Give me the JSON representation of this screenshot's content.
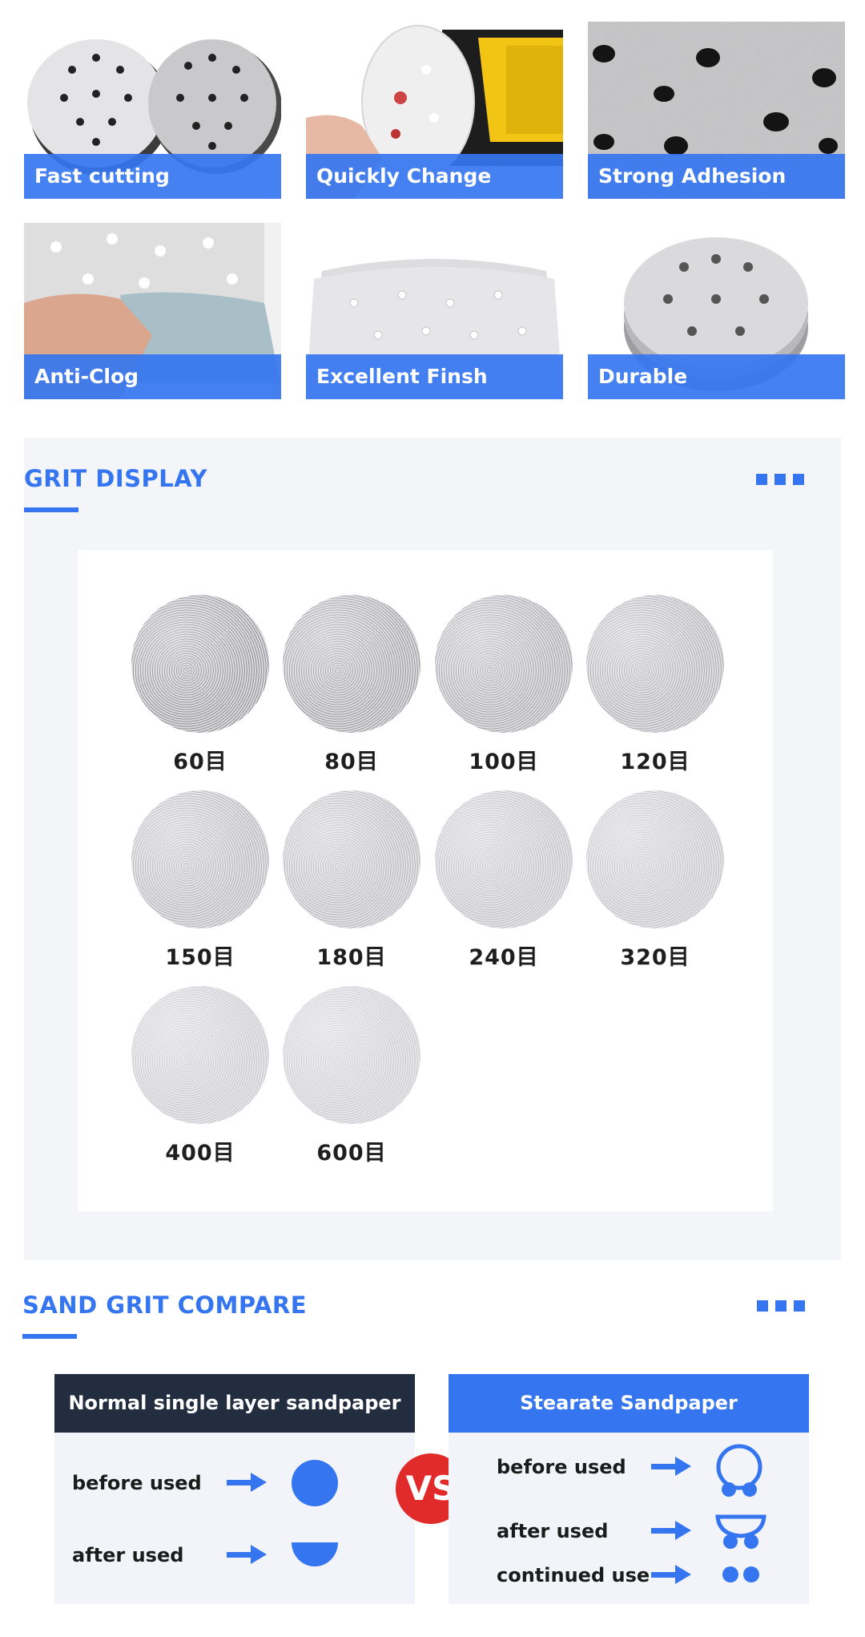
{
  "features": [
    {
      "label": "Fast cutting",
      "icon": "sanding-discs-photo"
    },
    {
      "label": "Quickly Change",
      "icon": "sander-disc-photo"
    },
    {
      "label": "Strong Adhesion",
      "icon": "abrasive-closeup-photo"
    },
    {
      "label": "Anti-Clog",
      "icon": "disc-backing-photo"
    },
    {
      "label": "Excellent Finsh",
      "icon": "stacked-discs-photo"
    },
    {
      "label": "Durable",
      "icon": "disc-stack-photo"
    }
  ],
  "grit_display": {
    "title": "GRIT DISPLAY",
    "items": [
      "60目",
      "80目",
      "100目",
      "120目",
      "150目",
      "180目",
      "240目",
      "320目",
      "400目",
      "600目"
    ]
  },
  "compare": {
    "title": "SAND GRIT COMPARE",
    "vs": "VS",
    "left": {
      "header": "Normal single layer sandpaper",
      "before": "before used",
      "after": "after used"
    },
    "right": {
      "header": "Stearate Sandpaper",
      "before": "before used",
      "after": "after used",
      "continued": "continued use"
    }
  },
  "colors": {
    "accent": "#3576f0",
    "dark_header": "#232d40",
    "vs_red": "#e12a2a",
    "section_bg": "#f4f5f9"
  }
}
